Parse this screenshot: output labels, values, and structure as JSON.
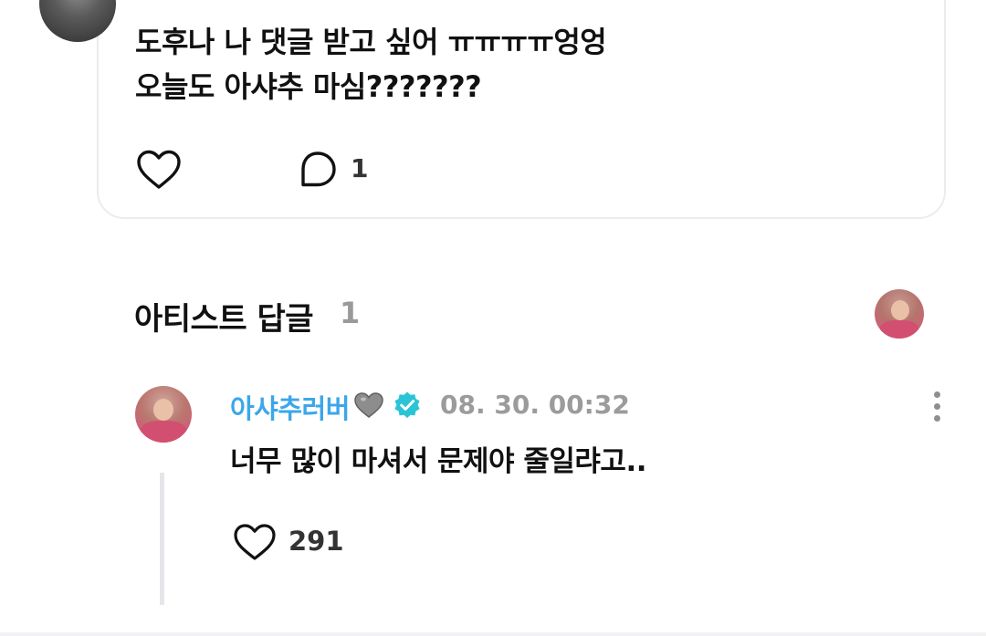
{
  "post": {
    "text_line1": "도후나 나 댓글 받고 싶어 ㅠㅠㅠㅠ엉엉",
    "text_line2": "오늘도 아샤추 마심???????",
    "comment_count": "1",
    "icons": {
      "like": "heart-outline-icon",
      "comment": "comment-bubble-icon",
      "more": "more-dots-icon"
    }
  },
  "artist_replies": {
    "title": "아티스트 답글",
    "count": "1"
  },
  "reply": {
    "author": "아샤추러버",
    "author_emoji": "grey-heart-icon",
    "verified": "verified-badge-icon",
    "timestamp": "08. 30. 00:32",
    "text": "너무 많이 마셔서 문제야 줄일랴고..",
    "like_count": "291"
  },
  "colors": {
    "accent_blue": "#3ca6ea",
    "verified_teal": "#2bc4d6",
    "muted_grey": "#9b9b9b",
    "card_border": "#ececec"
  }
}
